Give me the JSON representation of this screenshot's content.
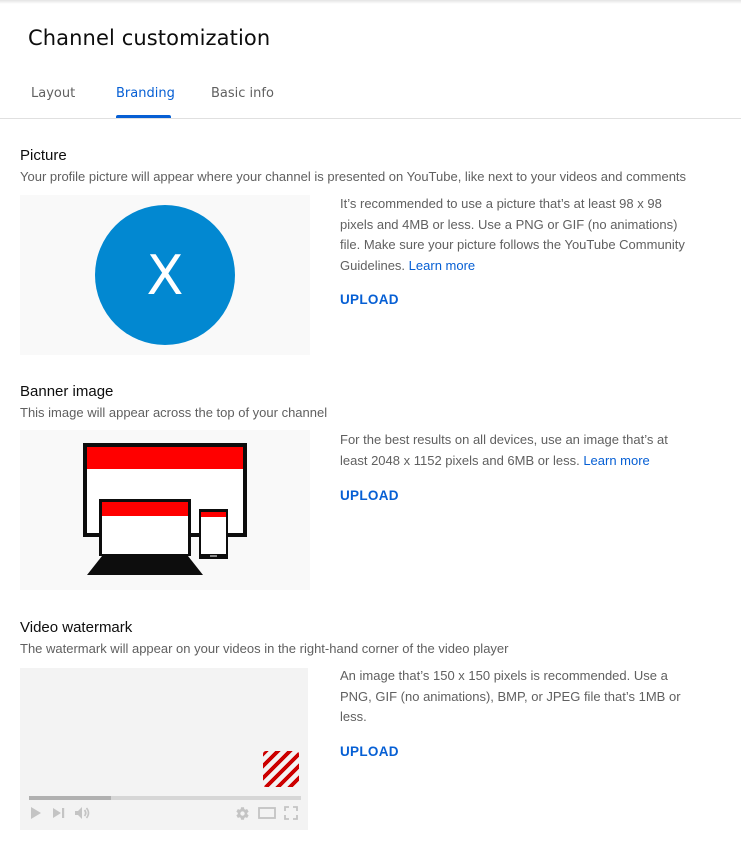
{
  "header": {
    "title": "Channel customization"
  },
  "tabs": [
    {
      "label": "Layout",
      "active": false
    },
    {
      "label": "Branding",
      "active": true
    },
    {
      "label": "Basic info",
      "active": false
    }
  ],
  "colors": {
    "accent": "#065fd4",
    "avatar_bg": "#0288d1",
    "banner_red": "#ff0000",
    "watermark_red": "#cc0000"
  },
  "picture": {
    "title": "Picture",
    "description": "Your profile picture will appear where your channel is presented on YouTube, like next to your videos and comments",
    "avatar_letter": "X",
    "info": "It’s recommended to use a picture that’s at least 98 x 98 pixels and 4MB or less. Use a PNG or GIF (no animations) file. Make sure your picture follows the YouTube Community Guidelines.",
    "learn_more": "Learn more",
    "upload_label": "UPLOAD"
  },
  "banner": {
    "title": "Banner image",
    "description": "This image will appear across the top of your channel",
    "info": "For the best results on all devices, use an image that’s at least 2048 x 1152 pixels and 6MB or less.",
    "learn_more": "Learn more",
    "upload_label": "UPLOAD",
    "illustration_icon": "devices-banner-icon"
  },
  "watermark": {
    "title": "Video watermark",
    "description": "The watermark will appear on your videos in the right-hand corner of the video player",
    "info": "An image that’s 150 x 150 pixels is recommended. Use a PNG, GIF (no animations), BMP, or JPEG file that’s 1MB or less.",
    "upload_label": "UPLOAD",
    "player": {
      "progress_percent": 30,
      "controls": [
        "play-icon",
        "next-icon",
        "volume-icon",
        "settings-icon",
        "theater-mode-icon",
        "fullscreen-icon"
      ]
    }
  }
}
